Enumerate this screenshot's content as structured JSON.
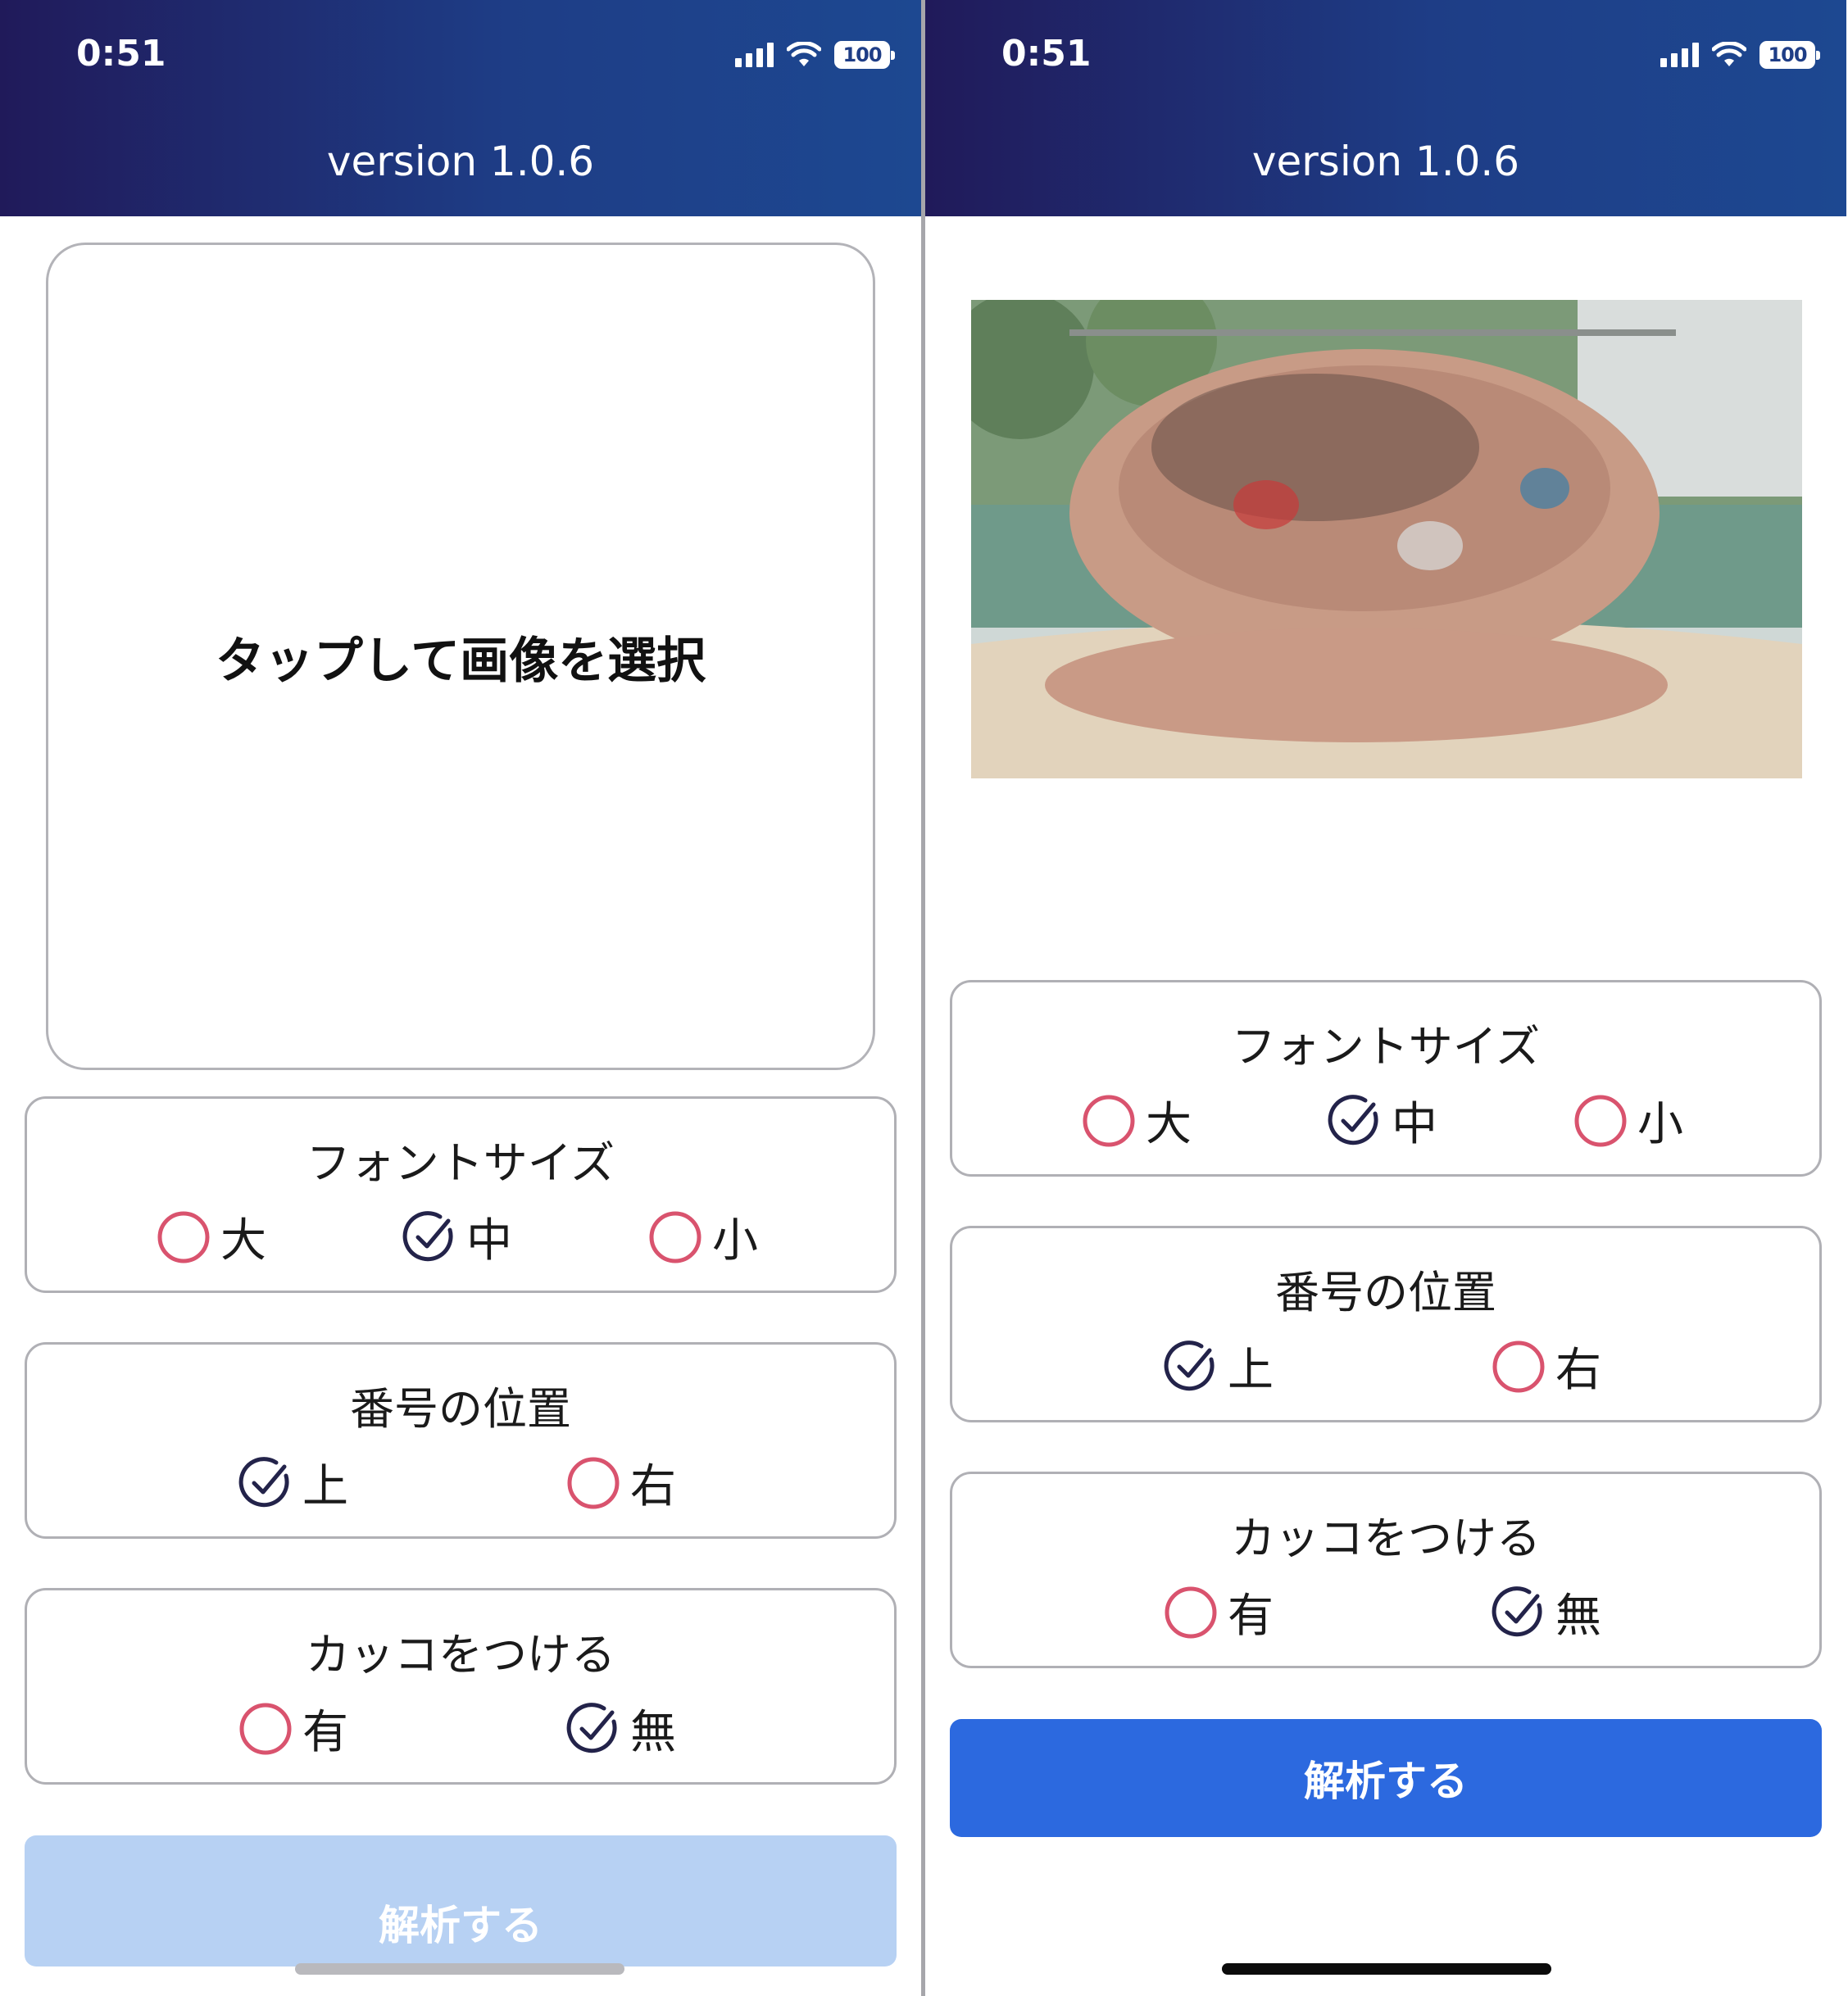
{
  "status_bar": {
    "time": "0:51",
    "battery": "100"
  },
  "app": {
    "title": "version 1.0.6"
  },
  "picker": {
    "prompt": "タップして画像を選択"
  },
  "photo": {
    "icon": "group-photo-image"
  },
  "font_size": {
    "title": "フォントサイズ",
    "options": [
      "大",
      "中",
      "小"
    ],
    "selected": "中"
  },
  "number_position": {
    "title": "番号の位置",
    "options": [
      "上",
      "右"
    ],
    "selected": "上"
  },
  "brackets": {
    "title": "カッコをつける",
    "options": [
      "有",
      "無"
    ],
    "selected": "無"
  },
  "analyze": {
    "label": "解析する"
  },
  "colors": {
    "unchecked": "#d9536e",
    "checked": "#23234a",
    "button_active": "#2c69df",
    "button_disabled": "#b7d1f3"
  }
}
